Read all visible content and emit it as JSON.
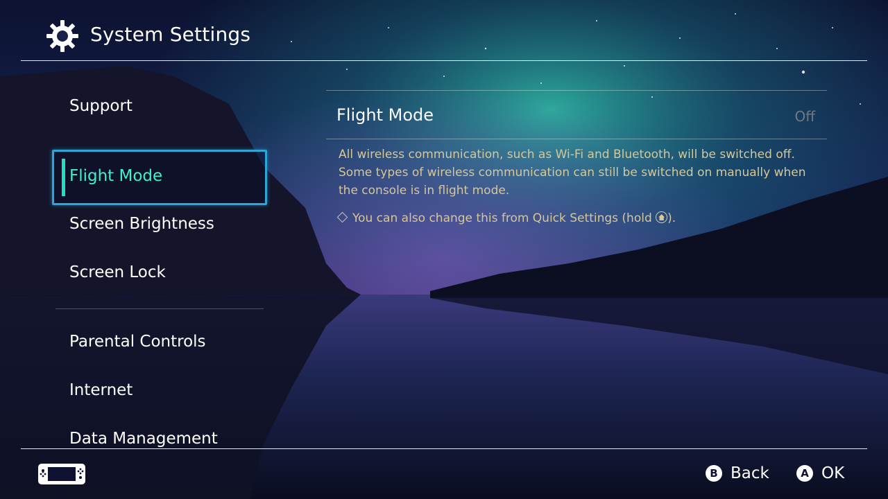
{
  "header": {
    "title": "System Settings",
    "icon": "gear-icon"
  },
  "sidebar": {
    "items": [
      {
        "label": "Support"
      },
      {
        "label": "Flight Mode",
        "selected": true
      },
      {
        "label": "Screen Brightness"
      },
      {
        "label": "Screen Lock"
      },
      {
        "label": "Parental Controls"
      },
      {
        "label": "Internet"
      },
      {
        "label": "Data Management"
      }
    ]
  },
  "panel": {
    "setting_name": "Flight Mode",
    "setting_value": "Off",
    "description": "All wireless communication, such as Wi-Fi and Bluetooth, will be switched off. Some types of wireless communication can still be switched on manually when the console is in flight mode.",
    "tip_text": "You can also change this from Quick Settings (hold",
    "tip_end": ")."
  },
  "footer": {
    "back_button": "B",
    "back_label": "Back",
    "ok_button": "A",
    "ok_label": "OK"
  },
  "colors": {
    "accent": "#23e0c2",
    "selection_border": "#2aa7d6",
    "description_text": "#d7c795"
  }
}
